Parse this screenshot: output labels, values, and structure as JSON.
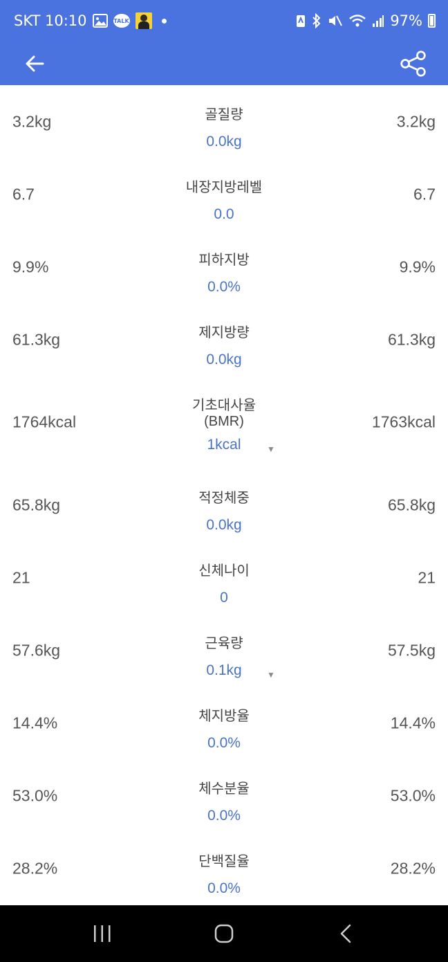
{
  "status_bar": {
    "carrier_time": "SKT 10:10",
    "talk_badge": "TALK",
    "battery_percent": "97%"
  },
  "app_bar": {
    "back_icon": "arrow-left-icon",
    "share_icon": "share-icon"
  },
  "rows": [
    {
      "left": "3.2kg",
      "label": "골질량",
      "diff": "0.0kg",
      "right": "3.2kg"
    },
    {
      "left": "6.7",
      "label": "내장지방레벨",
      "diff": "0.0",
      "right": "6.7"
    },
    {
      "left": "9.9%",
      "label": "피하지방",
      "diff": "0.0%",
      "right": "9.9%"
    },
    {
      "left": "61.3kg",
      "label": "제지방량",
      "diff": "0.0kg",
      "right": "61.3kg"
    },
    {
      "left": "1764kcal",
      "label": "기초대사율",
      "label_sub": "(BMR)",
      "diff": "1kcal",
      "right": "1763kcal",
      "trend": "down"
    },
    {
      "left": "65.8kg",
      "label": "적정체중",
      "diff": "0.0kg",
      "right": "65.8kg"
    },
    {
      "left": "21",
      "label": "신체나이",
      "diff": "0",
      "right": "21"
    },
    {
      "left": "57.6kg",
      "label": "근육량",
      "diff": "0.1kg",
      "right": "57.5kg",
      "trend": "down"
    },
    {
      "left": "14.4%",
      "label": "체지방율",
      "diff": "0.0%",
      "right": "14.4%"
    },
    {
      "left": "53.0%",
      "label": "체수분율",
      "diff": "0.0%",
      "right": "53.0%"
    },
    {
      "left": "28.2%",
      "label": "단백질율",
      "diff": "0.0%",
      "right": "28.2%"
    }
  ],
  "trend_glyph": "▼",
  "colors": {
    "primary": "#4a73e0",
    "diff_text": "#4a73c8",
    "value_text": "#555555",
    "nav_bar": "#000000"
  },
  "nav_bar": {
    "recents_icon": "recent-apps-icon",
    "home_icon": "home-icon",
    "back_icon": "back-chevron-icon"
  }
}
